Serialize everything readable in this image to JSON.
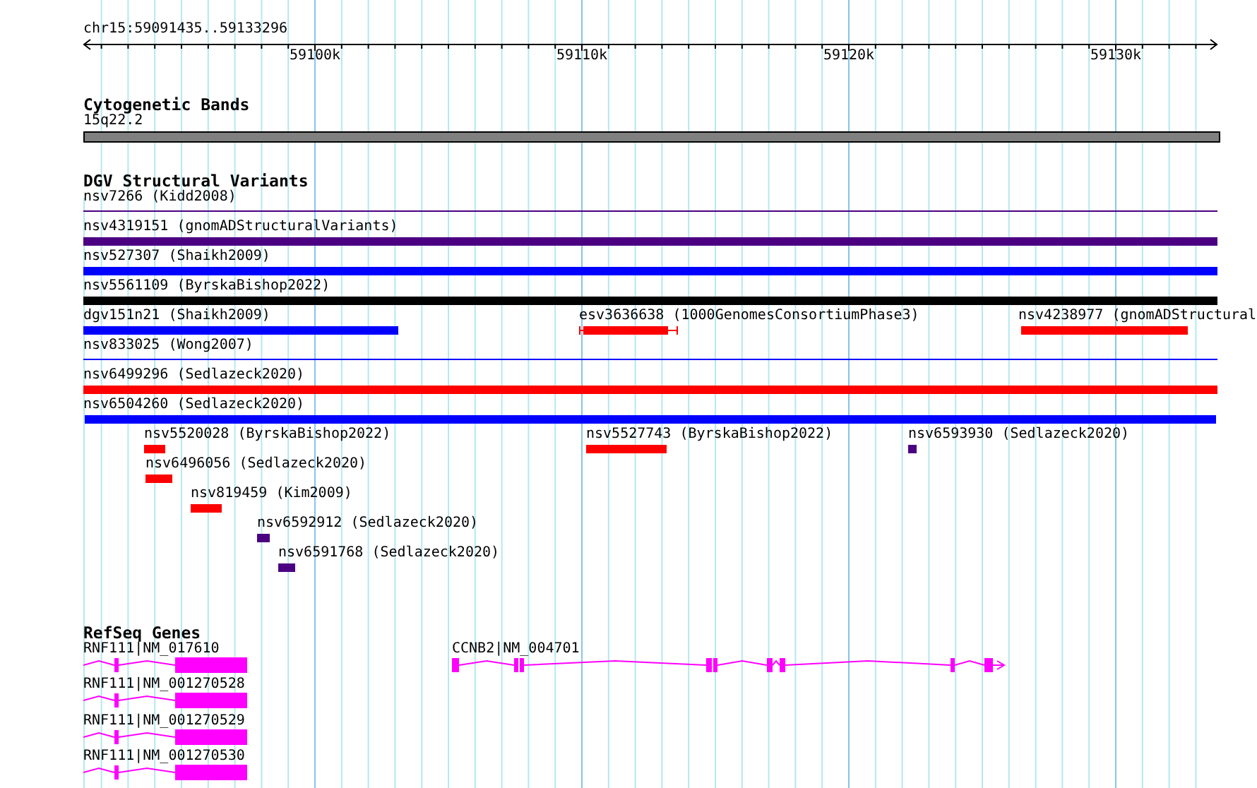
{
  "ruler": {
    "location": "chr15:59091435..59133296",
    "ticks": [
      "59100k",
      "59110k",
      "59120k",
      "59130k"
    ]
  },
  "cytoband": {
    "title": "Cytogenetic Bands",
    "band": {
      "label": "15q22.2",
      "color": "#808080"
    }
  },
  "dgv": {
    "title": "DGV Structural Variants",
    "rows": [
      {
        "features": [
          {
            "label": "nsv7266 (Kidd2008)",
            "kind": "line",
            "color": "#4b0082"
          }
        ]
      },
      {
        "features": [
          {
            "label": "nsv4319151 (gnomADStructuralVariants)",
            "kind": "bar",
            "color": "#4b0082"
          }
        ]
      },
      {
        "features": [
          {
            "label": "nsv527307 (Shaikh2009)",
            "kind": "bar",
            "color": "#0000ff"
          }
        ]
      },
      {
        "features": [
          {
            "label": "nsv5561109 (ByrskaBishop2022)",
            "kind": "bar",
            "color": "#000000"
          }
        ]
      },
      {
        "features": [
          {
            "label": "dgv151n21 (Shaikh2009)",
            "kind": "bar",
            "color": "#0000ff"
          },
          {
            "label": "esv3636638 (1000GenomesConsortiumPhase3)",
            "kind": "capped",
            "color": "#ff0000"
          },
          {
            "label": "nsv4238977 (gnomADStructural",
            "kind": "bar",
            "color": "#ff0000"
          }
        ]
      },
      {
        "features": [
          {
            "label": "nsv833025 (Wong2007)",
            "kind": "line",
            "color": "#0000ff"
          }
        ]
      },
      {
        "features": [
          {
            "label": "nsv6499296 (Sedlazeck2020)",
            "kind": "bar",
            "color": "#ff0000"
          }
        ]
      },
      {
        "features": [
          {
            "label": "nsv6504260 (Sedlazeck2020)",
            "kind": "bar",
            "color": "#0000ff"
          }
        ]
      },
      {
        "features": [
          {
            "label": "nsv5520028 (ByrskaBishop2022)",
            "kind": "bar",
            "color": "#ff0000"
          },
          {
            "label": "nsv5527743 (ByrskaBishop2022)",
            "kind": "bar",
            "color": "#ff0000"
          },
          {
            "label": "nsv6593930 (Sedlazeck2020)",
            "kind": "bar",
            "color": "#4b0082"
          }
        ]
      },
      {
        "features": [
          {
            "label": "nsv6496056 (Sedlazeck2020)",
            "kind": "bar",
            "color": "#ff0000"
          }
        ]
      },
      {
        "features": [
          {
            "label": "nsv819459 (Kim2009)",
            "kind": "bar",
            "color": "#ff0000"
          }
        ]
      },
      {
        "features": [
          {
            "label": "nsv6592912 (Sedlazeck2020)",
            "kind": "bar",
            "color": "#4b0082"
          }
        ]
      },
      {
        "features": [
          {
            "label": "nsv6591768 (Sedlazeck2020)",
            "kind": "bar",
            "color": "#4b0082"
          }
        ]
      }
    ]
  },
  "refseq": {
    "title": "RefSeq Genes",
    "genes": [
      {
        "label": "RNF111|NM_017610",
        "color": "#ff00ff"
      },
      {
        "label": "CCNB2|NM_004701",
        "color": "#ff00ff"
      },
      {
        "label": "RNF111|NM_001270528",
        "color": "#ff00ff"
      },
      {
        "label": "RNF111|NM_001270529",
        "color": "#ff00ff"
      },
      {
        "label": "RNF111|NM_001270530",
        "color": "#ff00ff"
      }
    ]
  }
}
